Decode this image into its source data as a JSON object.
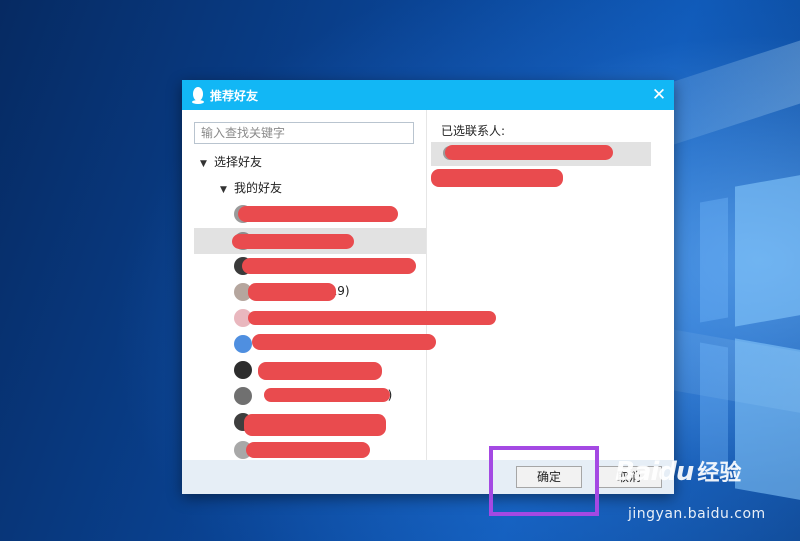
{
  "dialog": {
    "title": "推荐好友",
    "close_glyph": "✕",
    "search_placeholder": "输入查找关键字",
    "tree": {
      "root_label": "选择好友",
      "group_label": "我的好友",
      "arrow_glyph": "▼"
    },
    "friends": [
      {
        "suffix": ""
      },
      {
        "suffix": ""
      },
      {
        "suffix": ""
      },
      {
        "suffix": "419)"
      },
      {
        "suffix": ""
      },
      {
        "suffix": ""
      },
      {
        "suffix": ""
      },
      {
        "suffix": "3)"
      },
      {
        "suffix": ""
      },
      {
        "suffix": ""
      }
    ],
    "selected_header": "已选联系人:",
    "ok_label": "确定",
    "cancel_label": "取消"
  },
  "watermark": {
    "brand": "Baidu",
    "brand_cn": "经验",
    "url": "jingyan.baidu.com"
  },
  "colors": {
    "titlebar": "#12b7f5",
    "redaction": "#e94b4e",
    "highlight_box": "#a449e3"
  }
}
